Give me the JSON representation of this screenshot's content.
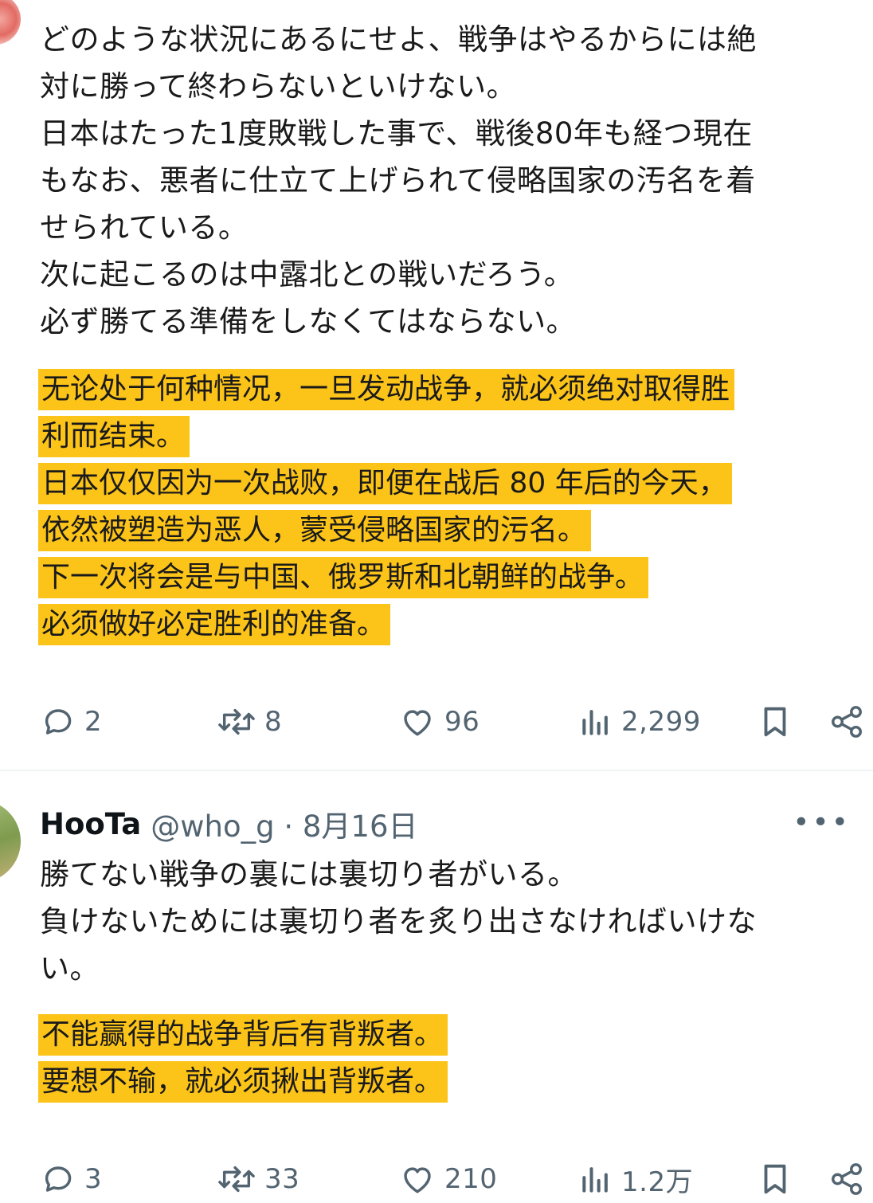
{
  "post1": {
    "japanese_lines": [
      "どのような状況にあるにせよ、戦争はやるからには絶",
      "対に勝って終わらないといけない。",
      "日本はたった1度敗戦した事で、戦後80年も経つ現在",
      "もなお、悪者に仕立て上げられて侵略国家の汚名を着",
      "せられている。",
      "次に起こるのは中露北との戦いだろう。",
      "必ず勝てる準備をしなくてはならない。"
    ],
    "chinese_lines": [
      "无论处于何种情况，一旦发动战争，就必须绝对取得胜",
      "利而结束。",
      "日本仅仅因为一次战败，即便在战后 80 年后的今天，",
      "依然被塑造为恶人，蒙受侵略国家的污名。",
      "下一次将会是与中国、俄罗斯和北朝鲜的战争。",
      "必须做好必定胜利的准备。"
    ],
    "actions": {
      "replies": "2",
      "reposts": "8",
      "likes": "96",
      "views": "2,299"
    }
  },
  "post2": {
    "author": "HooTa",
    "handle_date": "@who_g · 8月16日",
    "more": "•••",
    "japanese_lines": [
      "勝てない戦争の裏には裏切り者がいる。",
      "負けないためには裏切り者を炙り出さなければいけな",
      "い。"
    ],
    "chinese_lines": [
      "不能赢得的战争背后有背叛者。",
      "要想不输，就必须揪出背叛者。"
    ],
    "actions": {
      "replies": "3",
      "reposts": "33",
      "likes": "210",
      "views": "1.2万"
    }
  },
  "colors": {
    "highlight": "#fcc419",
    "muted": "#536471",
    "text": "#0f1419"
  }
}
